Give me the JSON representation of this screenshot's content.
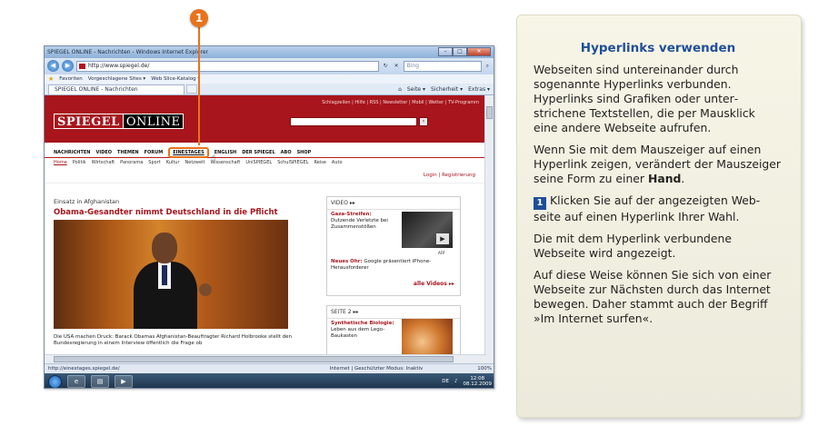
{
  "callout": {
    "number": "1"
  },
  "browser": {
    "title": "SPIEGEL ONLINE - Nachrichten - Windows Internet Explorer",
    "url": "http://www.spiegel.de/",
    "search_placeholder": "Bing",
    "favorites": [
      "Favoriten",
      "Vorgeschlagene Sites ▾",
      "Web Slice-Katalog ▾"
    ],
    "tab_title": "SPIEGEL ONLINE - Nachrichten",
    "tools": [
      "Seite ▾",
      "Sicherheit ▾",
      "Extras ▾"
    ],
    "status_url": "http://einestages.spiegel.de/",
    "status_zone": "Internet | Geschützter Modus: Inaktiv",
    "zoom": "100%",
    "tray": {
      "lang": "DE",
      "time": "12:08",
      "date": "08.12.2009"
    }
  },
  "site": {
    "topnav": "Schlagzeilen | Hilfe | RSS | Newsletter | Mobil | Wetter | TV-Programm",
    "logo_left": "SPIEGEL",
    "logo_right": "ONLINE",
    "search_button": "›",
    "mainnav": [
      "NACHRICHTEN",
      "VIDEO",
      "THEMEN",
      "FORUM"
    ],
    "mainnav_highlight": "EINESTAGES",
    "mainnav_rest": [
      "ENGLISH",
      "DER SPIEGEL",
      "ABO",
      "SHOP"
    ],
    "subnav": [
      "Home",
      "Politik",
      "Wirtschaft",
      "Panorama",
      "Sport",
      "Kultur",
      "Netzwelt",
      "Wissenschaft",
      "UniSPIEGEL",
      "SchulSPIEGEL",
      "Reise",
      "Auto"
    ],
    "login": "Login | Registrierung",
    "kicker": "Einsatz in Afghanistan",
    "headline": "Obama-Gesandter nimmt Deutschland in die Pflicht",
    "caption": "Die USA machen Druck: Barack Obamas Afghanistan-Beauftragter Richard Holbrooke stellt den Bundesregierung in einem Interview öffentlich die Frage ob",
    "video_box": {
      "header": "VIDEO ▸▸",
      "item1_bold": "Gaza-Streifen:",
      "item1_text": "Dutzende Verletzte bei Zusammenstößen",
      "img_credit": "AFP",
      "item2_bold": "Neues Ohr:",
      "item2_text": "Google präsentiert iPhone-Herausforderer",
      "more": "alle Videos ▸▸"
    },
    "page2_box": {
      "header": "SEITE 2 ▸▸",
      "item_bold": "Synthetische Biologie:",
      "item_text": "Leben aus dem Lego-Baukasten"
    }
  },
  "panel": {
    "title": "Hyperlinks verwenden",
    "p1": "Webseiten sind untereinander durch sogenannte Hyperlinks verbunden. Hyperlinks sind Grafiken oder unter­strichene Textstellen, die per Mausklick eine andere Webseite aufrufen.",
    "p2_a": "Wenn Sie mit dem Mauszeiger auf einen Hyperlink zeigen, verändert der Maus­zeiger seine Form zu einer ",
    "p2_b": "Hand",
    "p2_c": ".",
    "step_num": "1",
    "p3": "Klicken Sie auf der angezeigten Web­seite auf einen Hyperlink Ihrer Wahl.",
    "p4": "Die mit dem Hyperlink verbundene Webseite wird angezeigt.",
    "p5": "Auf diese Weise können Sie sich von einer Webseite zur Nächsten durch das Internet bewegen. Daher stammt auch der Begriff »Im Internet surfen«."
  }
}
